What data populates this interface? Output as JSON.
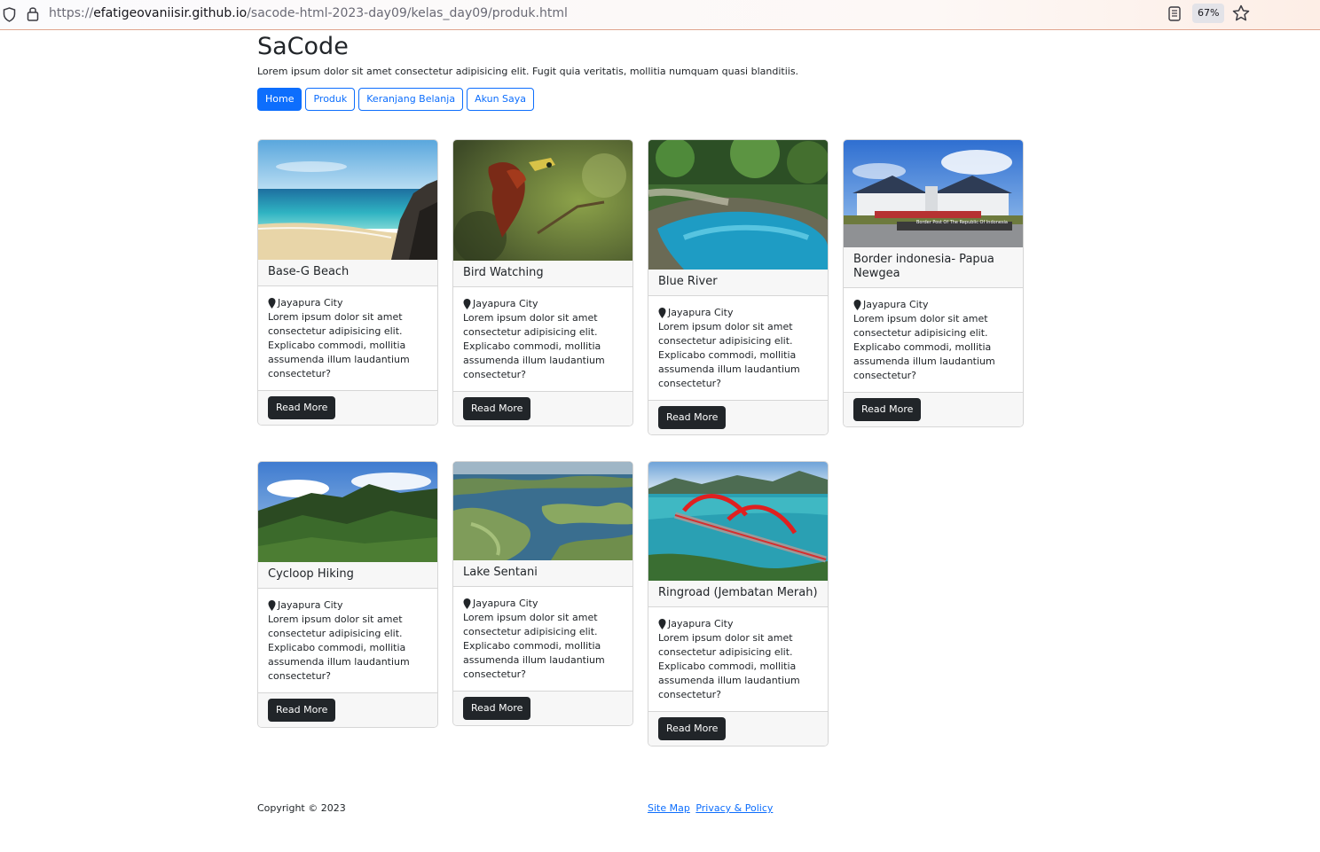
{
  "browser": {
    "url_prefix": "https://",
    "url_host": "efatigeovaniisir.github.io",
    "url_path": "/sacode-html-2023-day09/kelas_day09/produk.html",
    "zoom": "67%"
  },
  "header": {
    "brand": "SaCode",
    "tagline": "Lorem ipsum dolor sit amet consectetur adipisicing elit. Fugit quia veritatis, mollitia numquam quasi blanditiis."
  },
  "nav": {
    "items": [
      {
        "label": "Home"
      },
      {
        "label": "Produk"
      },
      {
        "label": "Keranjang Belanja"
      },
      {
        "label": "Akun Saya"
      }
    ]
  },
  "cards": [
    {
      "title": "Base-G Beach",
      "location": "Jayapura City",
      "text": "Lorem ipsum dolor sit amet consectetur adipisicing elit. Explicabo commodi, mollitia assumenda illum laudantium consectetur?",
      "button": "Read More"
    },
    {
      "title": "Bird Watching",
      "location": "Jayapura City",
      "text": "Lorem ipsum dolor sit amet consectetur adipisicing elit. Explicabo commodi, mollitia assumenda illum laudantium consectetur?",
      "button": "Read More"
    },
    {
      "title": "Blue River",
      "location": "Jayapura City",
      "text": "Lorem ipsum dolor sit amet consectetur adipisicing elit. Explicabo commodi, mollitia assumenda illum laudantium consectetur?",
      "button": "Read More"
    },
    {
      "title": "Border indonesia- Papua Newgea",
      "location": "Jayapura City",
      "text": "Lorem ipsum dolor sit amet consectetur adipisicing elit. Explicabo commodi, mollitia assumenda illum laudantium consectetur?",
      "button": "Read More",
      "image_caption": "Border Post Of The Republic Of Indonesia"
    },
    {
      "title": "Cycloop Hiking",
      "location": "Jayapura City",
      "text": "Lorem ipsum dolor sit amet consectetur adipisicing elit. Explicabo commodi, mollitia assumenda illum laudantium consectetur?",
      "button": "Read More"
    },
    {
      "title": "Lake Sentani",
      "location": "Jayapura City",
      "text": "Lorem ipsum dolor sit amet consectetur adipisicing elit. Explicabo commodi, mollitia assumenda illum laudantium consectetur?",
      "button": "Read More"
    },
    {
      "title": "Ringroad (Jembatan Merah)",
      "location": "Jayapura City",
      "text": "Lorem ipsum dolor sit amet consectetur adipisicing elit. Explicabo commodi, mollitia assumenda illum laudantium consectetur?",
      "button": "Read More"
    }
  ],
  "footer": {
    "copyright": "Copyright © 2023",
    "links": [
      {
        "label": "Site Map"
      },
      {
        "label": "Privacy & Policy"
      }
    ]
  },
  "colors": {
    "primary": "#0d6efd",
    "dark_button": "#212529",
    "card_header_bg": "#f7f7f7"
  }
}
